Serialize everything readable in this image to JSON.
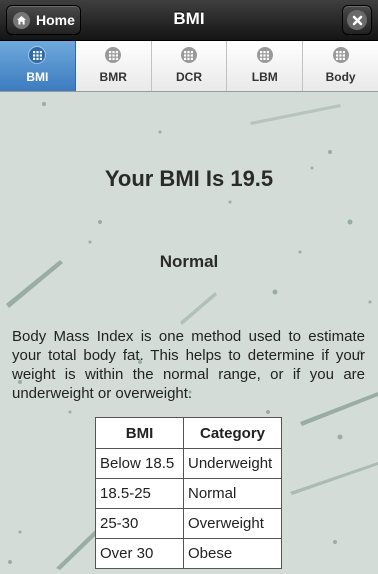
{
  "header": {
    "title": "BMI",
    "home_label": "Home",
    "home_icon": "home-icon",
    "close_icon": "close-icon"
  },
  "tabs": [
    {
      "label": "BMI",
      "icon": "grid-icon",
      "active": true
    },
    {
      "label": "BMR",
      "icon": "grid-icon",
      "active": false
    },
    {
      "label": "DCR",
      "icon": "grid-icon",
      "active": false
    },
    {
      "label": "LBM",
      "icon": "grid-icon",
      "active": false
    },
    {
      "label": "Body",
      "icon": "grid-icon",
      "active": false
    }
  ],
  "result": {
    "heading": "Your BMI Is 19.5",
    "category": "Normal"
  },
  "description": "Body Mass Index is one method used to estimate your total body fat. This helps to determine if your weight is within the normal range, or if you are underweight or overweight.",
  "table": {
    "headers": [
      "BMI",
      "Category"
    ],
    "rows": [
      [
        "Below 18.5",
        "Underweight"
      ],
      [
        "18.5-25",
        "Normal"
      ],
      [
        "25-30",
        "Overweight"
      ],
      [
        "Over 30",
        "Obese"
      ]
    ]
  },
  "colors": {
    "background": "#d4dcd8",
    "active_tab": "#4a8ccc",
    "header": "#1e1e1e"
  }
}
